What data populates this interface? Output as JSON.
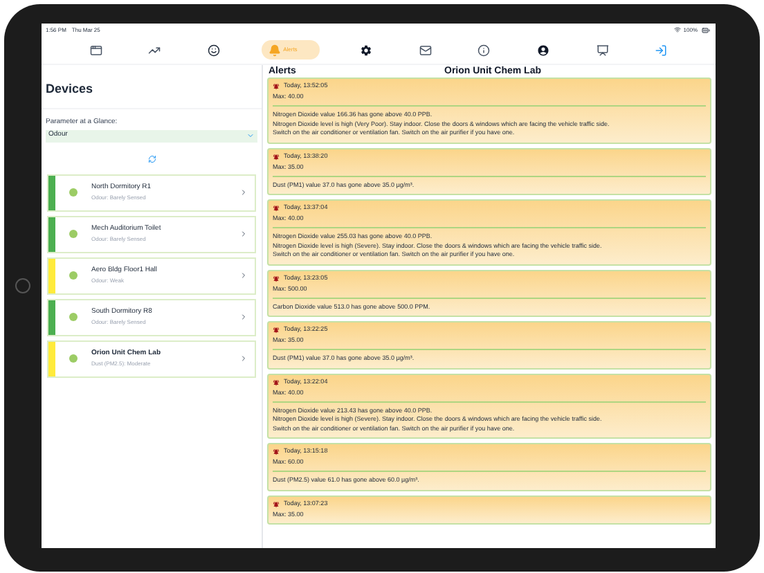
{
  "status_bar": {
    "time": "1:56 PM",
    "date": "Thu Mar 25",
    "battery": "100%"
  },
  "tabs": [
    {
      "kind": "dashboard",
      "selected": false
    },
    {
      "kind": "chart",
      "selected": false
    },
    {
      "kind": "face",
      "selected": false
    },
    {
      "kind": "alerts",
      "label": "Alerts",
      "selected": true
    },
    {
      "kind": "settings",
      "selected": false
    },
    {
      "kind": "mail",
      "selected": false
    },
    {
      "kind": "info",
      "selected": false
    },
    {
      "kind": "account",
      "selected": false
    },
    {
      "kind": "display",
      "selected": false
    },
    {
      "kind": "logout",
      "selected": false
    }
  ],
  "devices_panel": {
    "title": "Devices",
    "parameter_label": "Parameter at a Glance:",
    "parameter_value": "Odour",
    "devices": [
      {
        "name": "North Dormitory R1",
        "reading": "Odour: Barely Sensed",
        "color": "#4caf50",
        "selected": false
      },
      {
        "name": "Mech Auditorium Toilet",
        "reading": "Odour: Barely Sensed",
        "color": "#4caf50",
        "selected": false
      },
      {
        "name": "Aero Bldg Floor1 Hall",
        "reading": "Odour: Weak",
        "color": "#ffeb3b",
        "selected": false
      },
      {
        "name": "South Dormitory R8",
        "reading": "Odour: Barely Sensed",
        "color": "#4caf50",
        "selected": false
      },
      {
        "name": "Orion Unit Chem Lab",
        "reading": "Dust (PM2.5): Moderate",
        "color": "#ffeb3b",
        "selected": true
      }
    ]
  },
  "alerts_panel": {
    "title": "Alerts",
    "device": "Orion Unit Chem Lab",
    "alerts": [
      {
        "time": "Today, 13:52:05",
        "max": "Max: 40.00",
        "lines": [
          "Nitrogen Dioxide value 166.36 has gone above 40.0 PPB.",
          "Nitrogen Dioxide level is high (Very Poor). Stay indoor. Close the doors & windows which are facing the vehicle traffic side.",
          "Switch on the air conditioner or ventilation fan. Switch on the air purifier if you have one."
        ]
      },
      {
        "time": "Today, 13:38:20",
        "max": "Max: 35.00",
        "lines": [
          "Dust (PM1) value 37.0 has gone above 35.0 µg/m³."
        ]
      },
      {
        "time": "Today, 13:37:04",
        "max": "Max: 40.00",
        "lines": [
          "Nitrogen Dioxide value 255.03 has gone above 40.0 PPB.",
          "Nitrogen Dioxide level is high (Severe). Stay indoor. Close the doors & windows which are facing the vehicle traffic side.",
          "Switch on the air conditioner or ventilation fan. Switch on the air purifier if you have one."
        ]
      },
      {
        "time": "Today, 13:23:05",
        "max": "Max: 500.00",
        "lines": [
          "Carbon Dioxide value 513.0 has gone above 500.0 PPM."
        ]
      },
      {
        "time": "Today, 13:22:25",
        "max": "Max: 35.00",
        "lines": [
          "Dust (PM1) value 37.0 has gone above 35.0 µg/m³."
        ]
      },
      {
        "time": "Today, 13:22:04",
        "max": "Max: 40.00",
        "lines": [
          "Nitrogen Dioxide value 213.43 has gone above 40.0 PPB.",
          "Nitrogen Dioxide level is high (Severe). Stay indoor. Close the doors & windows which are facing the vehicle traffic side.",
          "Switch on the air conditioner or ventilation fan. Switch on the air purifier if you have one."
        ]
      },
      {
        "time": "Today, 13:15:18",
        "max": "Max: 60.00",
        "lines": [
          "Dust (PM2.5) value 61.0 has gone above 60.0 µg/m³."
        ]
      },
      {
        "time": "Today, 13:07:23",
        "max": "Max: 35.00"
      }
    ]
  }
}
